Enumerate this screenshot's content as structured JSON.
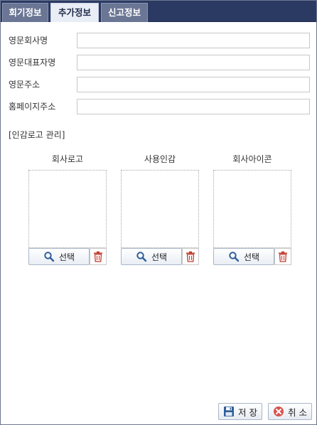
{
  "tabs": [
    {
      "label": "회기정보",
      "active": false
    },
    {
      "label": "추가정보",
      "active": true
    },
    {
      "label": "신고정보",
      "active": false
    }
  ],
  "fields": [
    {
      "label": "영문회사명",
      "value": ""
    },
    {
      "label": "영문대표자명",
      "value": ""
    },
    {
      "label": "영문주소",
      "value": ""
    },
    {
      "label": "홈페이지주소",
      "value": ""
    }
  ],
  "section_title": "[인감로고 관리]",
  "images": [
    {
      "caption": "회사로고",
      "select_label": "선택"
    },
    {
      "caption": "사용인감",
      "select_label": "선택"
    },
    {
      "caption": "회사아이콘",
      "select_label": "선택"
    }
  ],
  "footer": {
    "save_label": "저 장",
    "cancel_label": "취 소"
  },
  "colors": {
    "tabbar_bg": "#2b3a63",
    "tab_active_bg": "#e9edf5",
    "delete_icon": "#c0392b",
    "cancel_icon": "#d9534f",
    "save_icon": "#2f5d9a"
  }
}
